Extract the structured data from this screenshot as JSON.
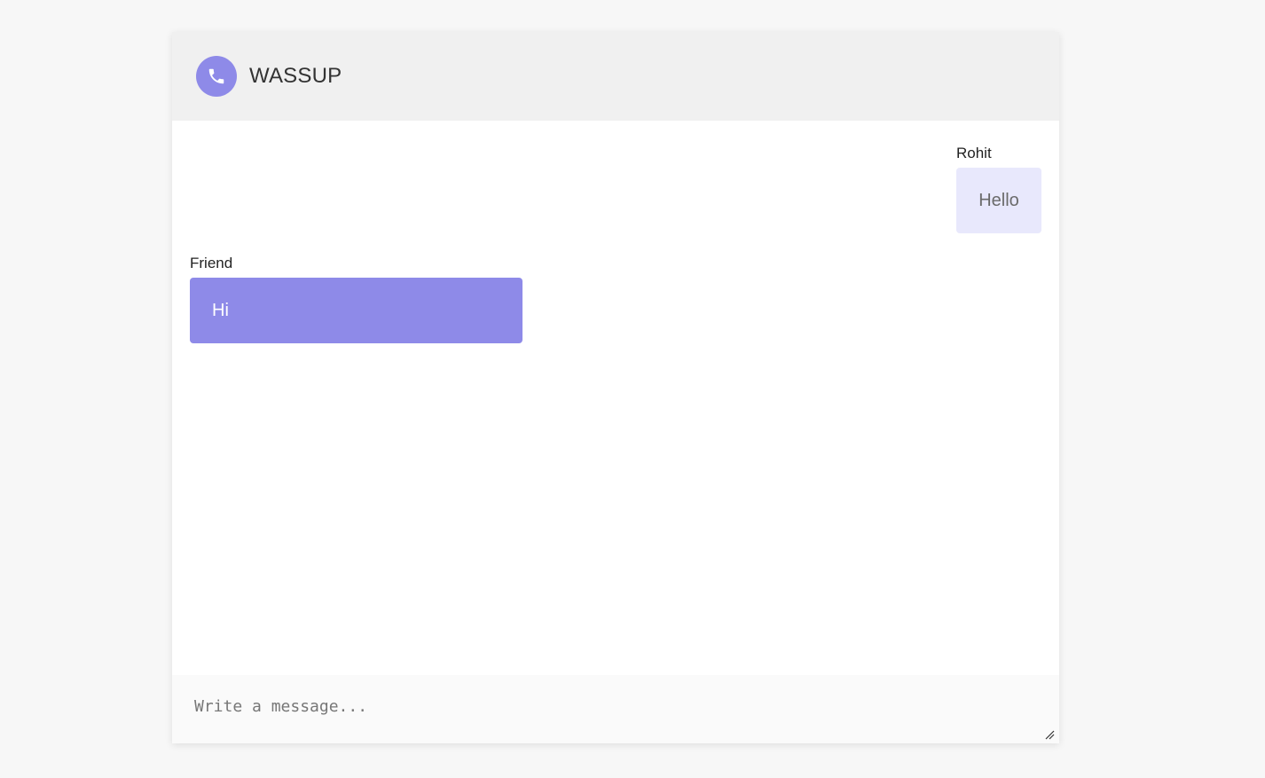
{
  "header": {
    "app_title": "WASSUP",
    "logo_icon": "phone-icon",
    "logo_color": "#8e8ae8"
  },
  "messages": [
    {
      "sender": "Rohit",
      "text": "Hello",
      "side": "right"
    },
    {
      "sender": "Friend",
      "text": "Hi",
      "side": "left"
    }
  ],
  "composer": {
    "placeholder": "Write a message...",
    "value": ""
  },
  "colors": {
    "accent": "#8e8ae8",
    "outgoing_bubble": "#e8e8fc",
    "header_bg": "#f0f0f0",
    "page_bg": "#f7f7f7"
  }
}
